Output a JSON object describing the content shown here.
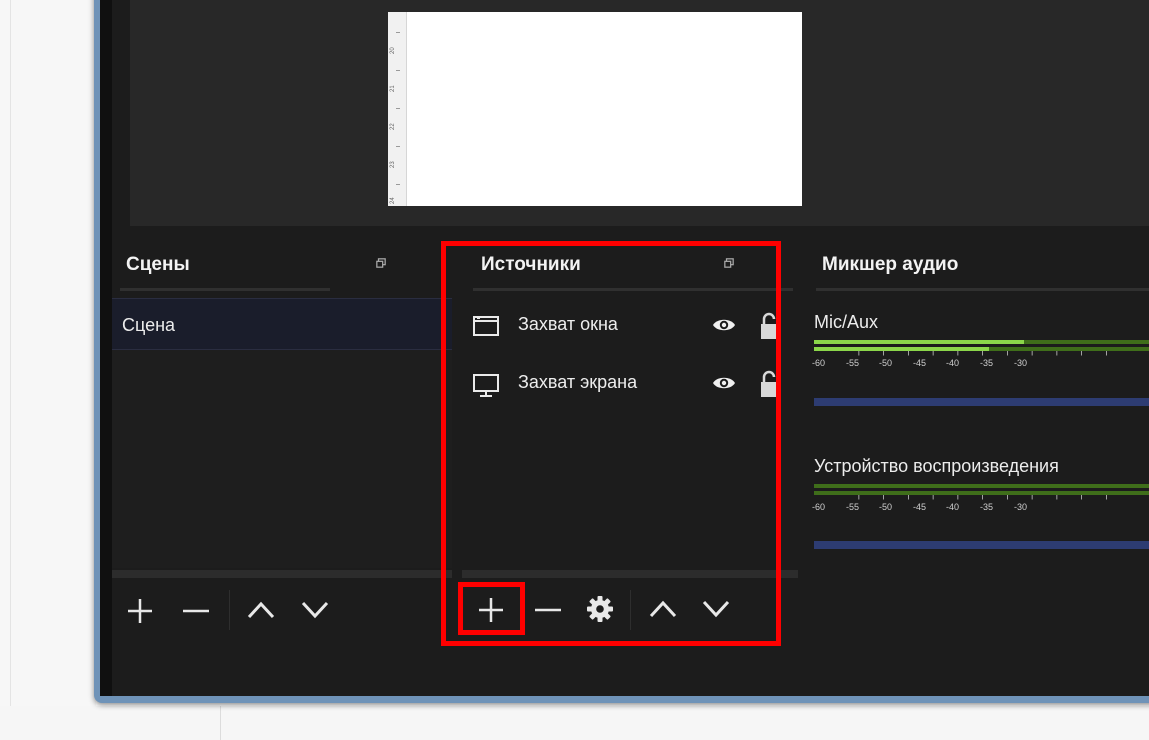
{
  "preview": {
    "ruler_numbers": [
      "20",
      "21",
      "22",
      "23",
      "24"
    ]
  },
  "scenes": {
    "title": "Сцены",
    "items": [
      "Сцена"
    ]
  },
  "sources": {
    "title": "Источники",
    "items": [
      {
        "label": "Захват окна",
        "icon": "window-icon"
      },
      {
        "label": "Захват экрана",
        "icon": "monitor-icon"
      }
    ]
  },
  "mixer": {
    "title": "Микшер аудио",
    "channels": [
      {
        "name": "Mic/Aux",
        "level_fraction": 0.52
      },
      {
        "name": "Устройство воспроизведения",
        "level_fraction": 0.0
      }
    ],
    "scale": [
      "-60",
      "-55",
      "-50",
      "-45",
      "-40",
      "-35",
      "-30"
    ]
  },
  "colors": {
    "highlight": "#ff0000",
    "meter_green": "#8bd64a",
    "volume_slider": "#2d3c72"
  }
}
